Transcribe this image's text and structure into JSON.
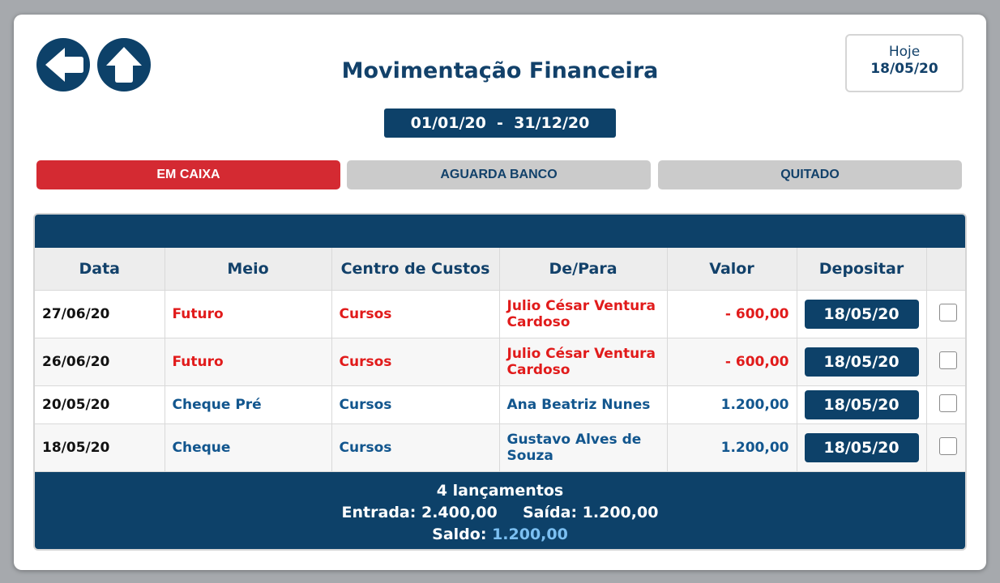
{
  "header": {
    "title": "Movimentação Financeira",
    "today_label": "Hoje",
    "today_value": "18/05/20",
    "date_range": "01/01/20  -  31/12/20"
  },
  "nav": {
    "back_icon": "arrow-left-icon",
    "up_icon": "arrow-up-icon"
  },
  "tabs": [
    {
      "label": "EM CAIXA",
      "active": true
    },
    {
      "label": "AGUARDA BANCO",
      "active": false
    },
    {
      "label": "QUITADO",
      "active": false
    }
  ],
  "table": {
    "columns": [
      "Data",
      "Meio",
      "Centro de Custos",
      "De/Para",
      "Valor",
      "Depositar"
    ],
    "rows": [
      {
        "data": "27/06/20",
        "meio": "Futuro",
        "centro": "Cursos",
        "depara": "Julio César Ventura Cardoso",
        "valor": "- 600,00",
        "depositar": "18/05/20",
        "checked": false,
        "tone": "red"
      },
      {
        "data": "26/06/20",
        "meio": "Futuro",
        "centro": "Cursos",
        "depara": "Julio César Ventura Cardoso",
        "valor": "- 600,00",
        "depositar": "18/05/20",
        "checked": false,
        "tone": "red"
      },
      {
        "data": "20/05/20",
        "meio": "Cheque Pré",
        "centro": "Cursos",
        "depara": "Ana Beatriz Nunes",
        "valor": "1.200,00",
        "depositar": "18/05/20",
        "checked": false,
        "tone": "blue"
      },
      {
        "data": "18/05/20",
        "meio": "Cheque",
        "centro": "Cursos",
        "depara": "Gustavo Alves de Souza",
        "valor": "1.200,00",
        "depositar": "18/05/20",
        "checked": false,
        "tone": "blue"
      }
    ]
  },
  "footer": {
    "count": "4 lançamentos",
    "entrada_label": "Entrada:",
    "entrada_value": "2.400,00",
    "saida_label": "Saída:",
    "saida_value": "1.200,00",
    "saldo_label": "Saldo:",
    "saldo_value": "1.200,00"
  },
  "colors": {
    "navy": "#0d4169",
    "active_tab": "#d42a32",
    "negative": "#e11b1b",
    "positive": "#12568e",
    "saldo": "#7cc0f2"
  }
}
